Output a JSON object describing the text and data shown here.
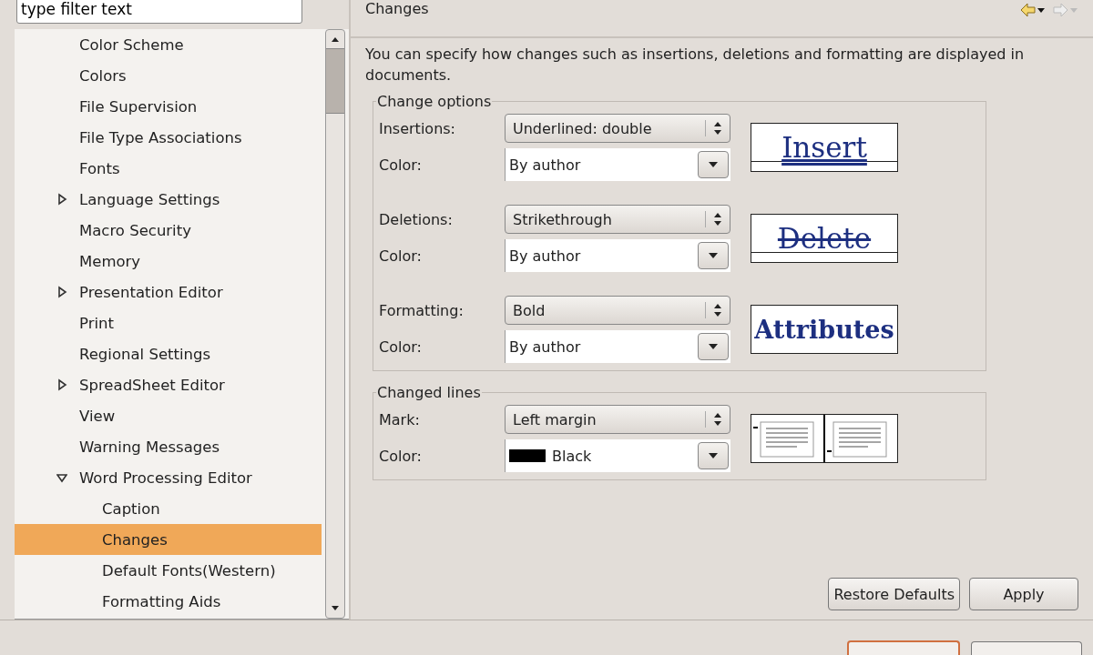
{
  "filter": {
    "value": "type filter text"
  },
  "tree": [
    {
      "label": "Color Scheme",
      "selected": false
    },
    {
      "label": "Colors",
      "selected": false
    },
    {
      "label": "File Supervision",
      "selected": false
    },
    {
      "label": "File Type Associations",
      "selected": false
    },
    {
      "label": "Fonts",
      "selected": false
    },
    {
      "label": "Language Settings",
      "selected": false,
      "expanded": false
    },
    {
      "label": "Macro Security",
      "selected": false
    },
    {
      "label": "Memory",
      "selected": false
    },
    {
      "label": "Presentation Editor",
      "selected": false,
      "expanded": false
    },
    {
      "label": "Print",
      "selected": false
    },
    {
      "label": "Regional Settings",
      "selected": false
    },
    {
      "label": "SpreadSheet Editor",
      "selected": false,
      "expanded": false
    },
    {
      "label": "View",
      "selected": false
    },
    {
      "label": "Warning Messages",
      "selected": false
    },
    {
      "label": "Word Processing Editor",
      "selected": false,
      "expanded": true,
      "children": [
        {
          "label": "Caption",
          "selected": false
        },
        {
          "label": "Changes",
          "selected": true
        },
        {
          "label": "Default Fonts(Western)",
          "selected": false
        },
        {
          "label": "Formatting Aids",
          "selected": false
        }
      ]
    }
  ],
  "page": {
    "title": "Changes",
    "nav": [
      {
        "kind": "back",
        "disabled": false
      },
      {
        "kind": "forward",
        "disabled": true
      }
    ],
    "description": "You can specify how changes such as insertions, deletions and formatting are displayed in documents.",
    "groups": [
      {
        "title": "Change options",
        "sets": [
          {
            "rows": [
              {
                "label": "Insertions:",
                "kind": "spin",
                "value": "Underlined: double"
              },
              {
                "label": "Color:",
                "kind": "dropdown",
                "value": "By author"
              }
            ],
            "preview": {
              "kind": "insert",
              "text": "Insert"
            }
          },
          {
            "rows": [
              {
                "label": "Deletions:",
                "kind": "spin",
                "value": "Strikethrough"
              },
              {
                "label": "Color:",
                "kind": "dropdown",
                "value": "By author"
              }
            ],
            "preview": {
              "kind": "delete",
              "text": "Delete"
            }
          },
          {
            "rows": [
              {
                "label": "Formatting:",
                "kind": "spin",
                "value": "Bold"
              },
              {
                "label": "Color:",
                "kind": "dropdown",
                "value": "By author"
              }
            ],
            "preview": {
              "kind": "attributes",
              "text": "Attributes"
            }
          }
        ]
      },
      {
        "title": "Changed lines",
        "sets": [
          {
            "rows": [
              {
                "label": "Mark:",
                "kind": "spin",
                "value": "Left margin"
              },
              {
                "label": "Color:",
                "kind": "dropdown",
                "value": "Black",
                "color": "#000000"
              }
            ],
            "preview": {
              "kind": "lines"
            }
          }
        ]
      }
    ],
    "buttons": [
      "Restore Defaults",
      "Apply"
    ]
  }
}
